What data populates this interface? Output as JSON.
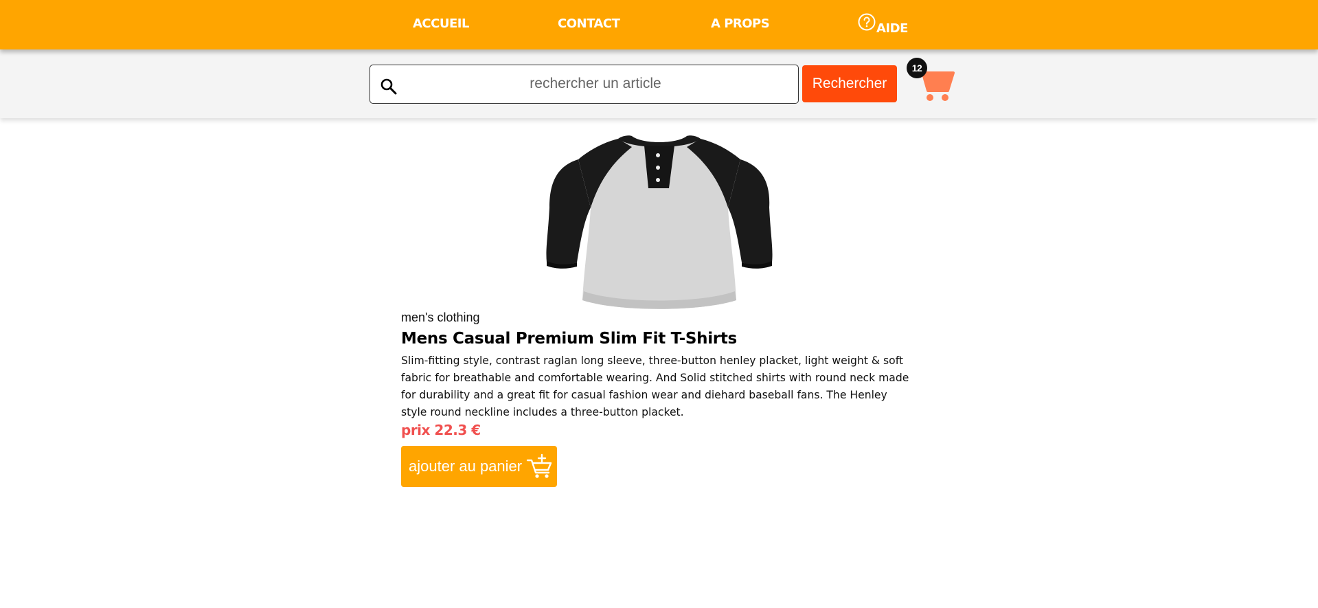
{
  "nav": {
    "items": [
      {
        "label": "ACCUEIL"
      },
      {
        "label": "CONTACT"
      },
      {
        "label": "A PROPS"
      },
      {
        "label": "AIDE",
        "icon": "help-circle-icon"
      }
    ]
  },
  "search": {
    "placeholder": "rechercher un article",
    "button_label": "Rechercher",
    "icon": "search-icon"
  },
  "cart": {
    "count": "12",
    "icon": "shopping-cart-icon"
  },
  "product": {
    "image": "raglan-henley-shirt-image",
    "category": "men's clothing",
    "title": "Mens Casual Premium Slim Fit T-Shirts",
    "description": "Slim-fitting style, contrast raglan long sleeve, three-button henley placket, light weight & soft fabric for breathable and comfortable wearing. And Solid stitched shirts with round neck made for durability and a great fit for casual fashion wear and diehard baseball fans. The Henley style round neckline includes a three-button placket.",
    "price": "prix 22.3 €",
    "add_to_cart_label": "ajouter au panier",
    "add_to_cart_icon": "cart-plus-icon"
  },
  "colors": {
    "nav_bg": "#ffa500",
    "search_button": "#ff4a0a",
    "cart_icon": "#ff7f50",
    "price": "#f0504f",
    "add_button": "#ffa500"
  }
}
